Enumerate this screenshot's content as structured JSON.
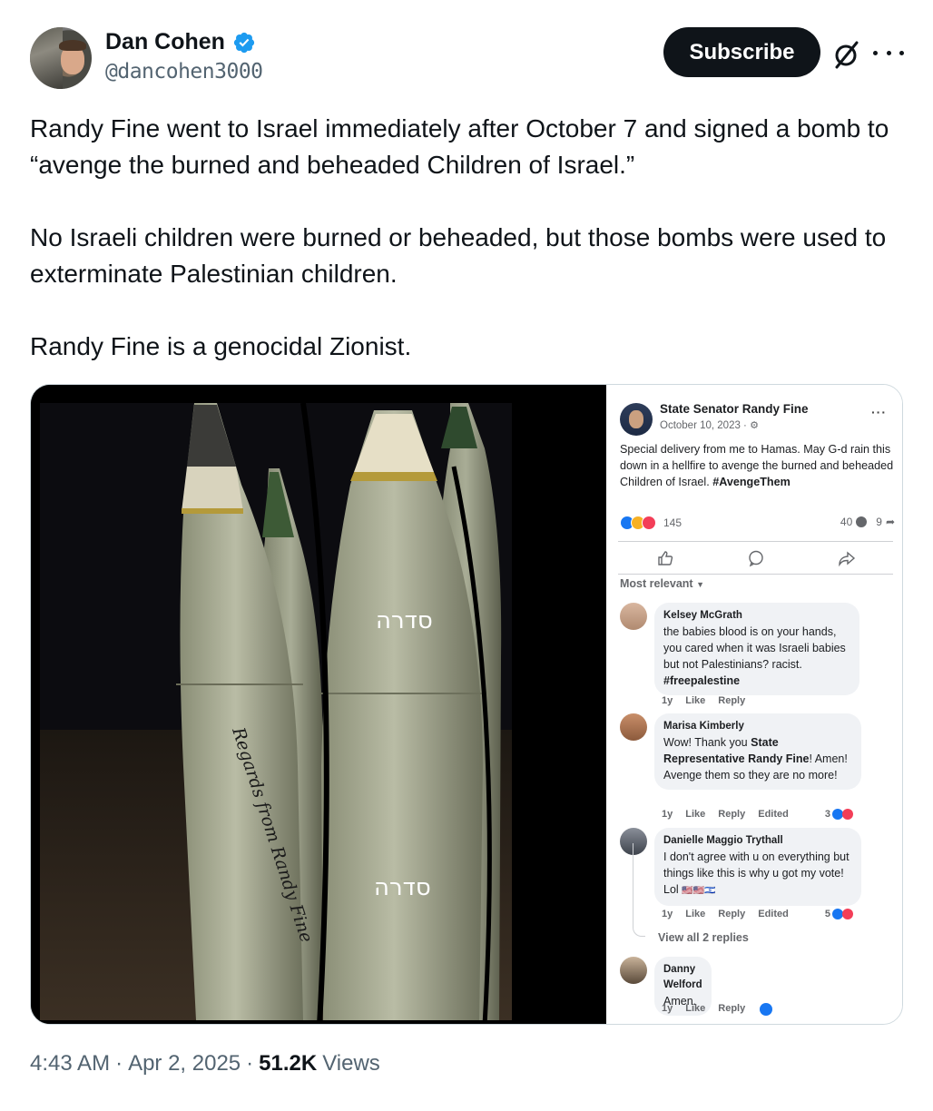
{
  "author": {
    "name": "Dan Cohen",
    "handle": "@dancohen3000",
    "verified": true
  },
  "header": {
    "subscribe_label": "Subscribe",
    "grok_icon": "grok-slashed-circle-icon",
    "more_icon": "more-horizontal-icon"
  },
  "tweet": {
    "paragraphs": [
      "Randy Fine went to Israel immediately after October 7 and signed a bomb to “avenge the burned and beheaded Children of Israel.”",
      "No Israeli children were burned or beheaded, but those bombs were used to exterminate Palestinian children.",
      "Randy Fine is a genocidal Zionist."
    ]
  },
  "photo": {
    "hebrew_label_1": "סדרה",
    "hebrew_label_2": "סדרה",
    "handwriting": "Regards from Randy Fine"
  },
  "fb_post": {
    "page_name": "State Senator Randy Fine",
    "date": "October 10, 2023 ·",
    "body_text": "Special delivery from me to Hamas. May G-d rain this down in a hellfire to avenge the burned and beheaded Children of Israel.",
    "hashtag": "#AvengeThem",
    "reaction_count": "145",
    "comment_count": "40",
    "share_count": "9",
    "sort_label": "Most relevant",
    "comments": [
      {
        "author": "Kelsey McGrath",
        "text": "the babies blood is on your hands, you cared when it was Israeli babies but not Palestinians? racist.",
        "tag": "#freepalestine",
        "age": "1y",
        "like": "Like",
        "reply": "Reply"
      },
      {
        "author": "Marisa Kimberly",
        "text_before": "Wow! Thank you",
        "text_bold": "State Representative Randy Fine",
        "text_after": "! Amen! Avenge them so they are no more!",
        "age": "1y",
        "like": "Like",
        "reply": "Reply",
        "edited": "Edited",
        "reactions": "3"
      },
      {
        "author": "Danielle Maggio Trythall",
        "text": "I don't agree with u on everything but things like this is why u got my vote! Lol",
        "flags": "🇺🇸🇺🇸🇮🇱",
        "age": "1y",
        "like": "Like",
        "reply": "Reply",
        "edited": "Edited",
        "reactions": "5"
      },
      {
        "author": "Danny Welford",
        "text": "Amen.",
        "age": "1y",
        "like": "Like",
        "reply": "Reply"
      }
    ],
    "view_replies": "View all 2 replies"
  },
  "footer": {
    "time": "4:43 AM",
    "sep1": "·",
    "date": "Apr 2, 2025",
    "sep2": "·",
    "views_count": "51.2K",
    "views_label": "Views"
  },
  "colors": {
    "subscribe_bg": "#0f1419",
    "verified": "#1d9bf0",
    "secondary_text": "#536471",
    "fb_like": "#1877f2",
    "fb_love": "#f33e58"
  }
}
